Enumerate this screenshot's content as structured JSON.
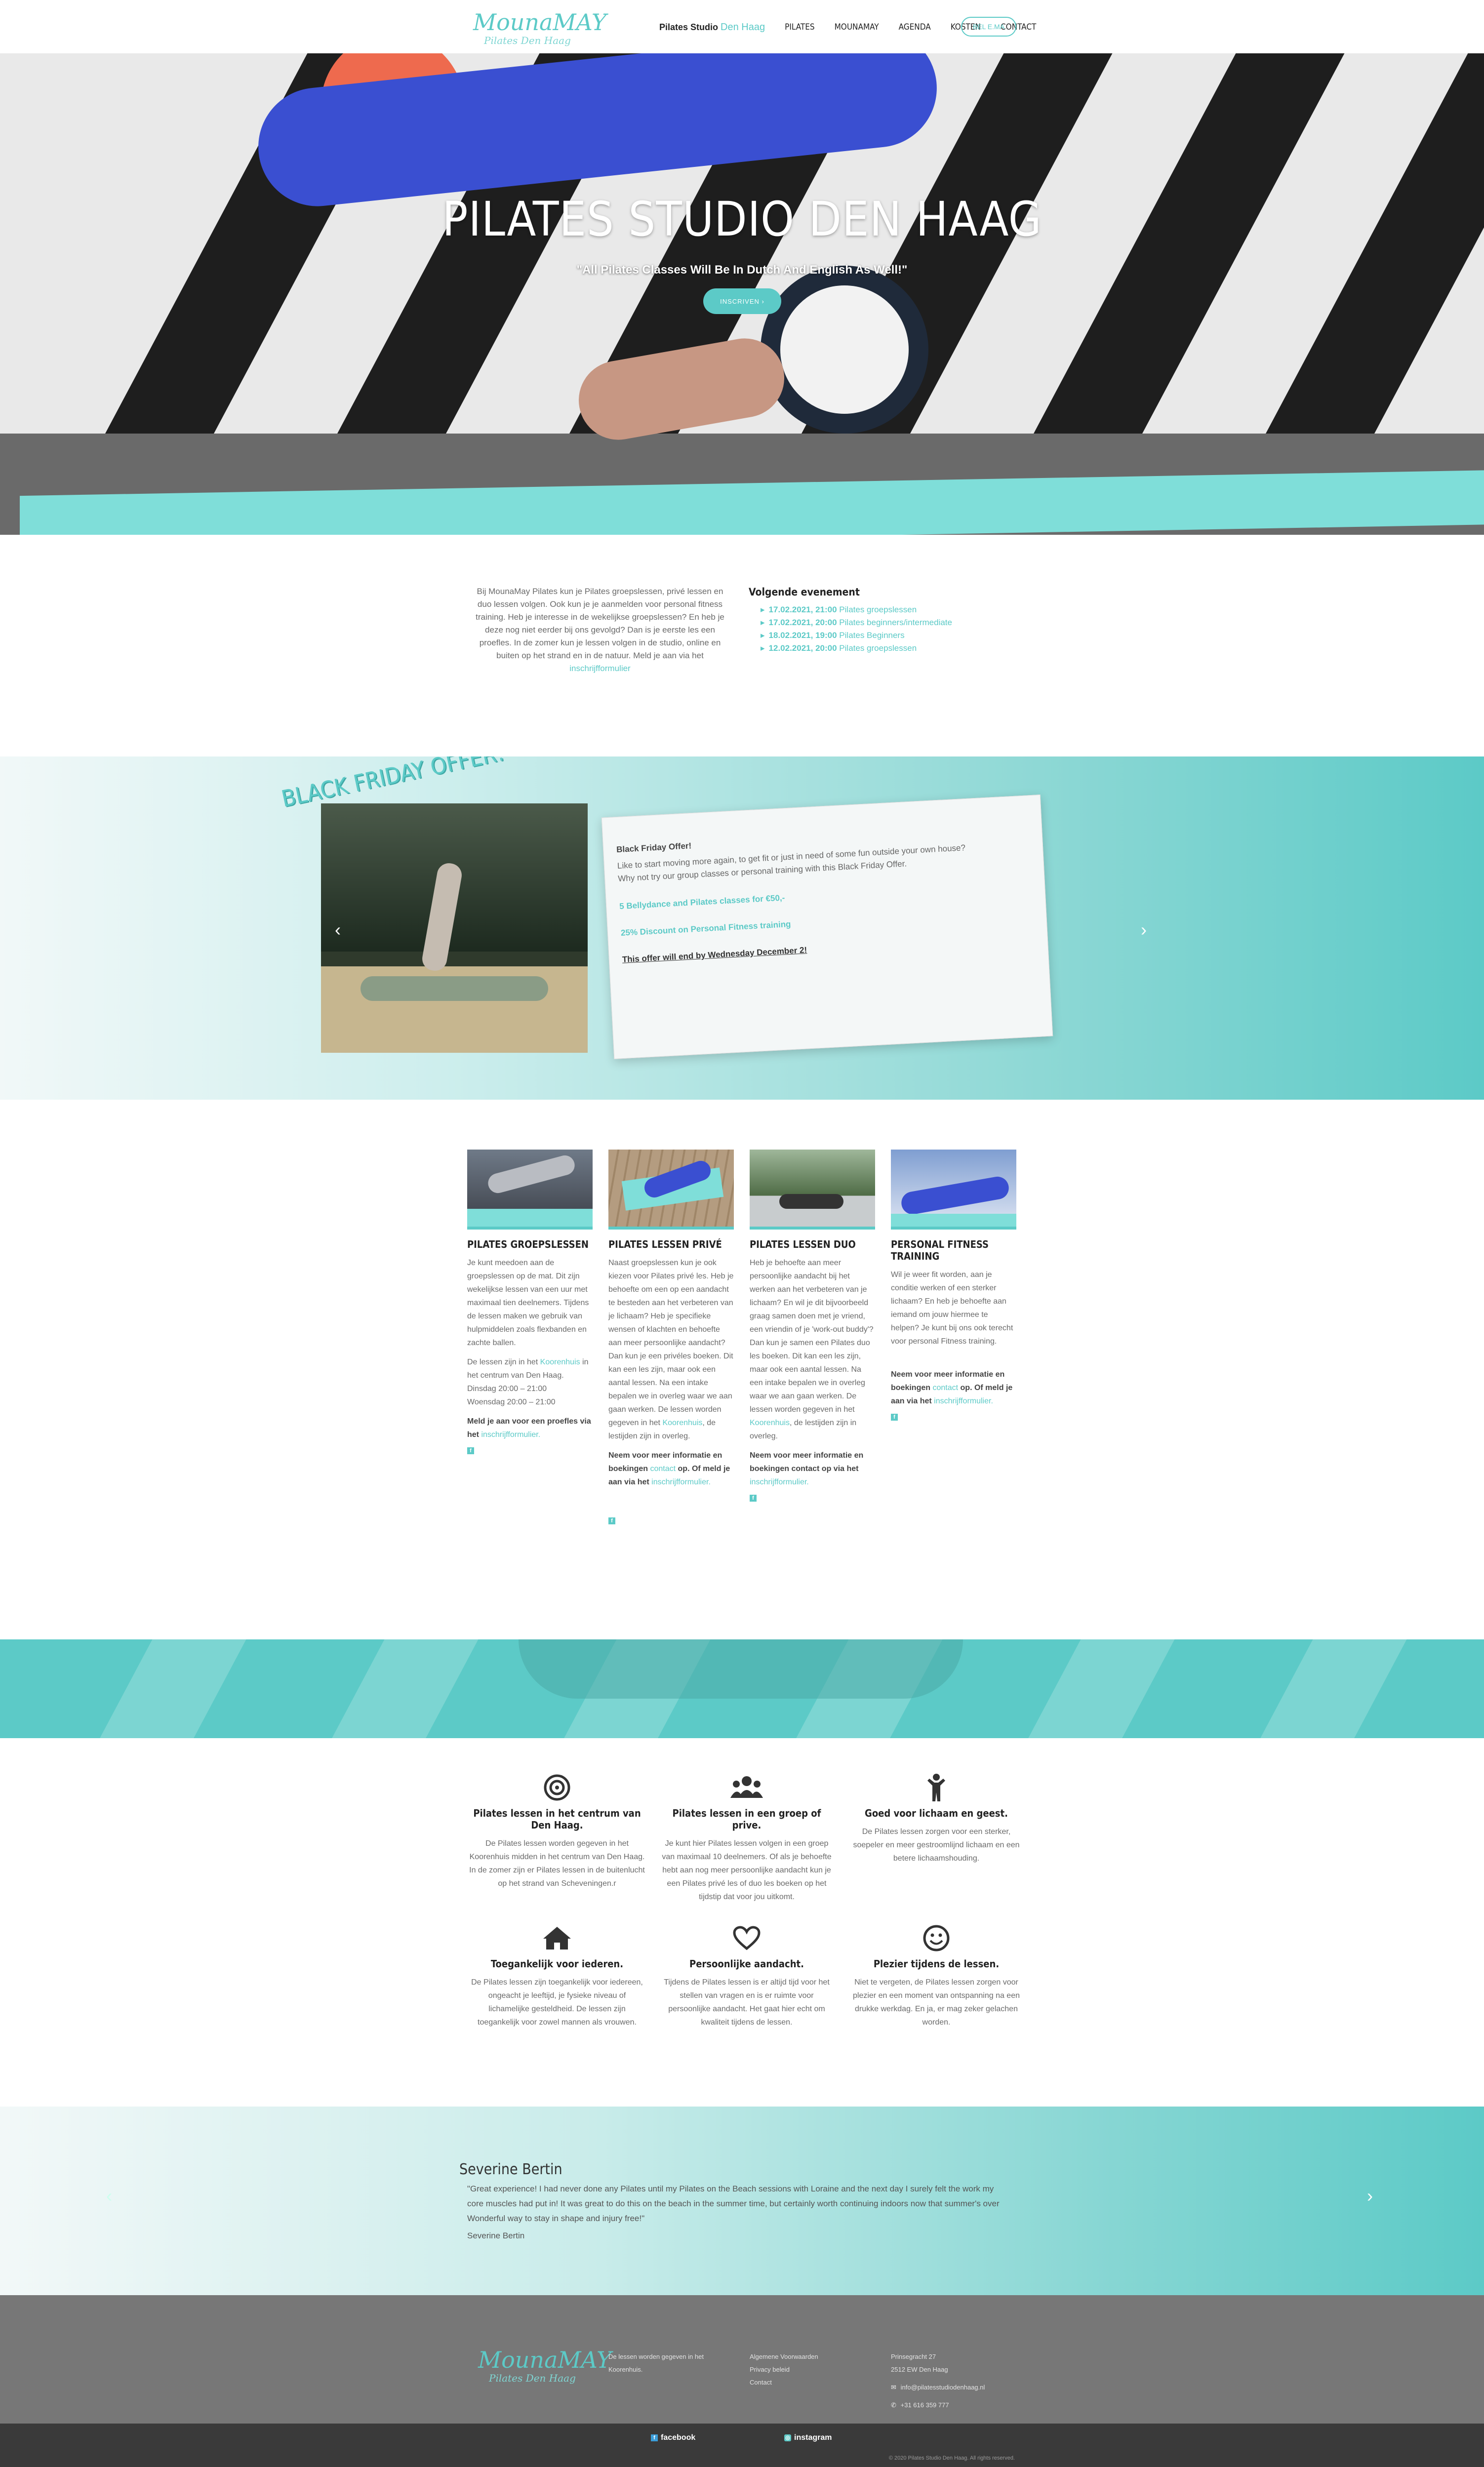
{
  "header": {
    "logo_line1": "MounaMAY",
    "logo_line2": "Pilates Den Haag",
    "nav_brand_plain": "Pilates Studio",
    "nav_brand_accent": "Den Haag",
    "nav_items": [
      "PILATES",
      "MOUNAMAY",
      "AGENDA",
      "KOSTEN",
      "CONTACT"
    ],
    "cta": "BEL E.MA"
  },
  "hero": {
    "title": "PILATES STUDIO DEN HAAG",
    "subtitle": "\"All Pilates Classes Will Be In Dutch And English As Well!\"",
    "button": "INSCRIVEN ›"
  },
  "intro": {
    "text_before": "Bij MounaMay Pilates kun je Pilates groepslessen, privé lessen en duo lessen volgen. Ook kun je je aanmelden voor personal fitness training. Heb je interesse in de wekelijkse groepslessen? En heb je deze nog niet eerder bij ons gevolgd? Dan is je eerste les een proefles. In de zomer kun je lessen volgen in de studio, online en buiten op het strand en in de natuur. Meld je aan via het",
    "link": "inschrijfformulier"
  },
  "events": {
    "title": "Volgende evenement",
    "items": [
      {
        "date": "17.02.2021, 21:00",
        "label": "Pilates groepslessen"
      },
      {
        "date": "17.02.2021, 20:00",
        "label": "Pilates beginners/intermediate"
      },
      {
        "date": "18.02.2021, 19:00",
        "label": "Pilates Beginners"
      },
      {
        "date": "12.02.2021, 20:00",
        "label": "Pilates groepslessen"
      }
    ]
  },
  "black_friday": {
    "badge": "BLACK FRIDAY OFFER!",
    "card_title": "Black Friday Offer!",
    "card_line1": "Like to start moving more again, to get fit or just in need of some fun outside your own house?",
    "card_line2": "Why not try our group classes or personal training with this Black Friday Offer.",
    "offer1": "5 Bellydance and Pilates classes for €50,-",
    "offer2": "25% Discount on Personal Fitness training",
    "ends": "This offer will end by Wednesday December 2!",
    "prev": "‹",
    "next": "›"
  },
  "services": [
    {
      "title": "PILATES GROEPSLESSEN",
      "p1": "Je kunt meedoen aan de groepslessen op de mat. Dit zijn wekelijkse lessen van een uur met maximaal tien deelnemers. Tijdens de lessen maken we gebruik van hulpmiddelen zoals flexbanden en zachte ballen.",
      "p2_before": "De lessen zijn in het",
      "p2_link": "Koorenhuis",
      "p2_after": "in het centrum van Den Haag.",
      "p2_days": "Dinsdag 20:00 – 21:00",
      "p2_days2": "Woensdag 20:00 – 21:00",
      "p3_bold": "Meld je aan voor een proefles via het",
      "p3_link": "inschrijfformulier.",
      "fb": "f"
    },
    {
      "title": "PILATES LESSEN PRIVÉ",
      "p1_before": "Naast groepslessen kun je ook kiezen voor Pilates privé les. Heb je behoefte om een op een aandacht te besteden aan het verbeteren van je lichaam? Heb je specifieke wensen of klachten en behoefte aan meer persoonlijke aandacht? Dan kun je een privéles boeken. Dit kan een les zijn, maar ook een aantal lessen. Na een intake bepalen we in overleg waar we aan gaan werken. De lessen worden gegeven in het",
      "p1_link": "Koorenhuis",
      "p1_after": ", de lestijden zijn in overleg.",
      "p2_bold1": "Neem voor meer informatie en boekingen",
      "p2_link1": "contact",
      "p2_bold2": "op. Of meld je aan via het",
      "p2_link2": "inschrijfformulier.",
      "fb": "f"
    },
    {
      "title": "PILATES LESSEN DUO",
      "p1_before": "Heb je behoefte aan meer persoonlijke aandacht bij het werken aan het verbeteren van je lichaam? En wil je dit bijvoorbeeld graag samen doen met je vriend, een vriendin of je 'work-out buddy'? Dan kun je samen een Pilates duo les boeken. Dit kan een les zijn, maar ook een aantal lessen. Na een intake bepalen we in overleg waar we aan gaan werken. De lessen worden gegeven in het",
      "p1_link": "Koorenhuis",
      "p1_after": ", de lestijden zijn in overleg.",
      "p2_bold": "Neem voor meer informatie en boekingen contact op via het",
      "p2_link": "inschrijfformulier.",
      "fb": "f"
    },
    {
      "title": "PERSONAL FITNESS TRAINING",
      "p1": "Wil je weer fit worden, aan je conditie werken of een sterker lichaam? En heb je behoefte aan iemand om jouw hiermee te helpen? Je kunt bij ons ook terecht voor personal Fitness training.",
      "p2_bold1": "Neem voor meer informatie en boekingen",
      "p2_link1": "contact",
      "p2_bold2": "op. Of meld je aan via het",
      "p2_link2": "inschrijfformulier.",
      "fb": "f"
    }
  ],
  "features": [
    {
      "icon": "target-icon",
      "title": "Pilates lessen in het centrum van Den Haag.",
      "text": "De Pilates lessen worden gegeven in het Koorenhuis midden in het centrum van Den Haag. In de zomer zijn er Pilates lessen in de buitenlucht op het strand van Scheveningen.r"
    },
    {
      "icon": "group-icon",
      "title": "Pilates lessen in een groep of prive.",
      "text": "Je kunt hier Pilates lessen volgen in een groep van maximaal 10 deelnemers. Of als je behoefte hebt aan nog meer persoonlijke aandacht kun je een Pilates privé les of duo les boeken op het tijdstip dat voor jou uitkomt."
    },
    {
      "icon": "person-icon",
      "title": "Goed voor lichaam en geest.",
      "text": "De Pilates lessen zorgen voor een sterker, soepeler en meer gestroomlijnd lichaam en een betere lichaamshouding."
    },
    {
      "icon": "home-icon",
      "title": "Toegankelijk voor iederen.",
      "text": "De Pilates lessen zijn toegankelijk voor iedereen, ongeacht je leeftijd, je fysieke niveau of lichamelijke gesteldheid. De lessen zijn toegankelijk voor zowel mannen als vrouwen."
    },
    {
      "icon": "heart-icon",
      "title": "Persoonlijke aandacht.",
      "text": "Tijdens de Pilates lessen is er altijd tijd voor het stellen van vragen en is er ruimte voor persoonlijke aandacht. Het gaat hier echt om kwaliteit tijdens de lessen."
    },
    {
      "icon": "smile-icon",
      "title": "Plezier tijdens de lessen.",
      "text": "Niet te vergeten, de Pilates lessen zorgen voor plezier en een moment van ontspanning na een drukke werkdag. En ja, er mag zeker gelachen worden."
    }
  ],
  "testimonial": {
    "name": "Severine Bertin",
    "quote": "\"Great experience! I had never done any Pilates until my Pilates on the Beach sessions with Loraine and the next day I surely felt the work my core muscles had put in! It was great to do this on the beach in the summer time, but certainly worth continuing indoors now that summer's over Wonderful way to stay in shape and injury free!\"",
    "by": "Severine Bertin",
    "prev": "‹",
    "next": "›"
  },
  "footer": {
    "logo_line1": "MounaMAY",
    "logo_line2": "Pilates Den Haag",
    "col2": "De lessen worden gegeven in het Koorenhuis.",
    "col3": [
      "Algemene Voorwaarden",
      "Privacy beleid",
      "Contact"
    ],
    "address1": "Prinsegracht 27",
    "address2": "2512 EW Den Haag",
    "email": "info@pilatesstudiodenhaag.nl",
    "phone": "+31 616 359 777",
    "social1": "facebook",
    "social2": "instagram",
    "copyright": "© 2020 Pilates Studio Den Haag. All rights reserved."
  },
  "colors": {
    "accent": "#5ccac7",
    "footer": "#777777",
    "bottombar": "#3a3a3a"
  }
}
